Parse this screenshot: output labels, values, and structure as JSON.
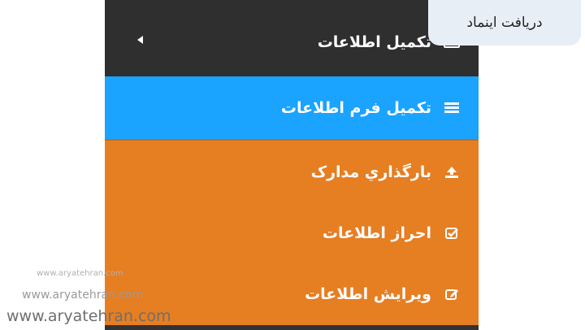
{
  "menu": {
    "header_label": "تکمیل اطلاعات",
    "items": [
      {
        "label": "تکمیل فرم اطلاعات",
        "icon": "list-icon",
        "active": true
      },
      {
        "label": "بارگذاري مدارک",
        "icon": "upload-icon"
      },
      {
        "label": "احراز اطلاعات",
        "icon": "check-square-icon"
      },
      {
        "label": "ويرايش اطلاعات",
        "icon": "edit-icon"
      }
    ]
  },
  "badge": {
    "label": "دریافت اینماد"
  },
  "watermarks": [
    "www.aryatehran.com",
    "www.aryatehran.com",
    "www.aryatehran.com"
  ],
  "colors": {
    "header_bg": "#2f2f2f",
    "active_bg": "#1aa3ff",
    "menu_bg": "#e67e22",
    "badge_bg": "#e8eef6"
  }
}
